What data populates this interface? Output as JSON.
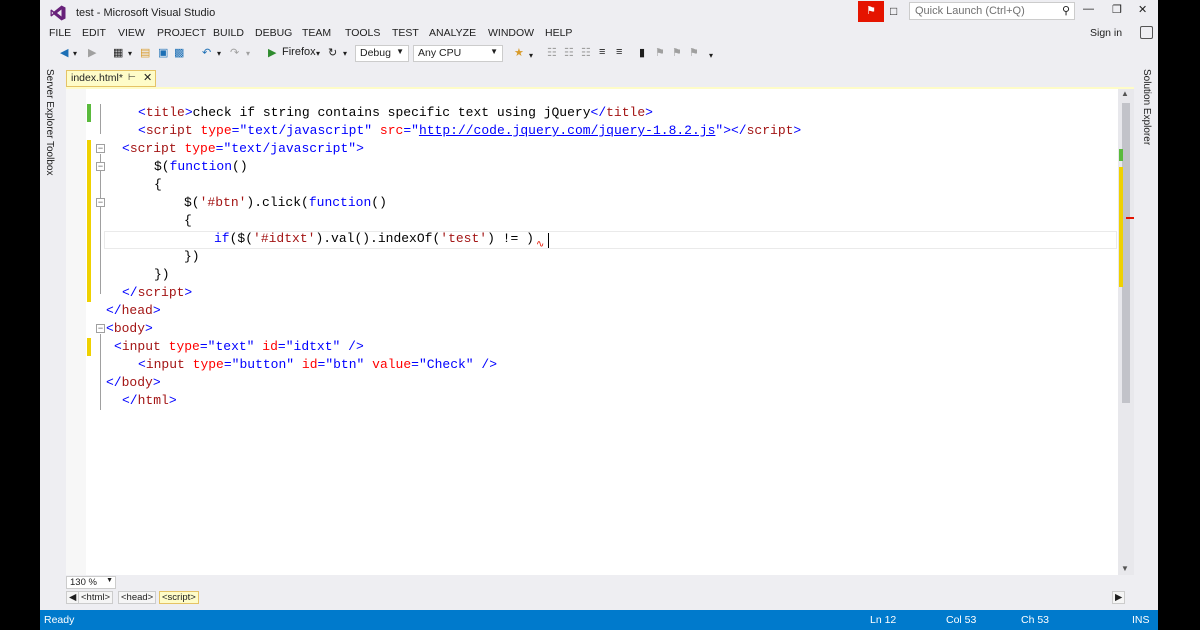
{
  "window": {
    "title": "test - Microsoft Visual Studio",
    "quick_launch_placeholder": "Quick Launch (Ctrl+Q)",
    "sign_in": "Sign in"
  },
  "menu": [
    "FILE",
    "EDIT",
    "VIEW",
    "PROJECT",
    "BUILD",
    "DEBUG",
    "TEAM",
    "TOOLS",
    "TEST",
    "ANALYZE",
    "WINDOW",
    "HELP"
  ],
  "toolbar": {
    "browser": "Firefox",
    "configuration": "Debug",
    "platform": "Any CPU"
  },
  "side_tabs": {
    "left": [
      "Server Explorer",
      "Toolbox"
    ],
    "right": "Solution Explorer"
  },
  "document_tab": {
    "name": "index.html*"
  },
  "code_lines": [
    {
      "parts": [
        [
          "tag-punc",
          "<"
        ],
        [
          "tag",
          "title"
        ],
        [
          "tag-punc",
          ">"
        ],
        [
          "plain",
          "check if string contains specific text using jQuery"
        ],
        [
          "tag-punc",
          "</"
        ],
        [
          "tag",
          "title"
        ],
        [
          "tag-punc",
          ">"
        ]
      ]
    },
    {
      "parts": [
        [
          "tag-punc",
          "<"
        ],
        [
          "tag",
          "script"
        ],
        [
          "plain",
          " "
        ],
        [
          "attr",
          "type"
        ],
        [
          "punc",
          "="
        ],
        [
          "val",
          "\"text/javascript\""
        ],
        [
          "plain",
          " "
        ],
        [
          "attr",
          "src"
        ],
        [
          "punc",
          "="
        ],
        [
          "val",
          "\""
        ],
        [
          "url",
          "http://code.jquery.com/jquery-1.8.2.js"
        ],
        [
          "val",
          "\""
        ],
        [
          "tag-punc",
          "></"
        ],
        [
          "tag",
          "script"
        ],
        [
          "tag-punc",
          ">"
        ]
      ]
    },
    {
      "parts": [
        [
          "tag-punc",
          "<"
        ],
        [
          "tag",
          "script"
        ],
        [
          "plain",
          " "
        ],
        [
          "attr",
          "type"
        ],
        [
          "punc",
          "="
        ],
        [
          "val",
          "\"text/javascript\""
        ],
        [
          "tag-punc",
          ">"
        ]
      ]
    },
    {
      "parts": [
        [
          "plain",
          "$("
        ],
        [
          "kw",
          "function"
        ],
        [
          "plain",
          "()"
        ]
      ]
    },
    {
      "parts": [
        [
          "plain",
          "{"
        ]
      ]
    },
    {
      "parts": [
        [
          "plain",
          "$("
        ],
        [
          "str",
          "'#btn'"
        ],
        [
          "plain",
          ").click("
        ],
        [
          "kw",
          "function"
        ],
        [
          "plain",
          "()"
        ]
      ]
    },
    {
      "parts": [
        [
          "plain",
          "{"
        ]
      ]
    },
    {
      "parts": [
        [
          "kw",
          "if"
        ],
        [
          "plain",
          "($("
        ],
        [
          "str",
          "'#idtxt'"
        ],
        [
          "plain",
          ").val().indexOf("
        ],
        [
          "str",
          "'test'"
        ],
        [
          "plain",
          ") != "
        ],
        [
          "plain",
          ")"
        ]
      ]
    },
    {
      "parts": [
        [
          "plain",
          "})"
        ]
      ]
    },
    {
      "parts": [
        [
          "plain",
          "})"
        ]
      ]
    },
    {
      "parts": [
        [
          "tag-punc",
          "</"
        ],
        [
          "tag",
          "script"
        ],
        [
          "tag-punc",
          ">"
        ]
      ]
    },
    {
      "parts": [
        [
          "tag-punc",
          "</"
        ],
        [
          "tag",
          "head"
        ],
        [
          "tag-punc",
          ">"
        ]
      ]
    },
    {
      "parts": [
        [
          "tag-punc",
          "<"
        ],
        [
          "tag",
          "body"
        ],
        [
          "tag-punc",
          ">"
        ]
      ]
    },
    {
      "parts": [
        [
          "tag-punc",
          "<"
        ],
        [
          "tag",
          "input"
        ],
        [
          "plain",
          " "
        ],
        [
          "attr",
          "type"
        ],
        [
          "punc",
          "="
        ],
        [
          "val",
          "\"text\""
        ],
        [
          "plain",
          " "
        ],
        [
          "attr",
          "id"
        ],
        [
          "punc",
          "="
        ],
        [
          "val",
          "\"idtxt\""
        ],
        [
          "plain",
          " "
        ],
        [
          "tag-punc",
          "/>"
        ]
      ]
    },
    {
      "parts": [
        [
          "tag-punc",
          "<"
        ],
        [
          "tag",
          "input"
        ],
        [
          "plain",
          " "
        ],
        [
          "attr",
          "type"
        ],
        [
          "punc",
          "="
        ],
        [
          "val",
          "\"button\""
        ],
        [
          "plain",
          " "
        ],
        [
          "attr",
          "id"
        ],
        [
          "punc",
          "="
        ],
        [
          "val",
          "\"btn\""
        ],
        [
          "plain",
          " "
        ],
        [
          "attr",
          "value"
        ],
        [
          "punc",
          "="
        ],
        [
          "val",
          "\"Check\""
        ],
        [
          "plain",
          " "
        ],
        [
          "tag-punc",
          "/>"
        ]
      ]
    },
    {
      "parts": [
        [
          "tag-punc",
          "</"
        ],
        [
          "tag",
          "body"
        ],
        [
          "tag-punc",
          ">"
        ]
      ]
    },
    {
      "parts": [
        [
          "tag-punc",
          "</"
        ],
        [
          "tag",
          "html"
        ],
        [
          "tag-punc",
          ">"
        ]
      ]
    }
  ],
  "editor_footer": {
    "zoom": "130 %",
    "breadcrumbs": [
      "<html>",
      "<head>",
      "<script>"
    ]
  },
  "status": {
    "state": "Ready",
    "line": "Ln 12",
    "col": "Col 53",
    "ch": "Ch 53",
    "mode": "INS"
  },
  "colors": {
    "accent": "#007acc",
    "vs_purple": "#68217a",
    "notification_red": "#e51400",
    "tab_yellow": "#fefcc8"
  }
}
